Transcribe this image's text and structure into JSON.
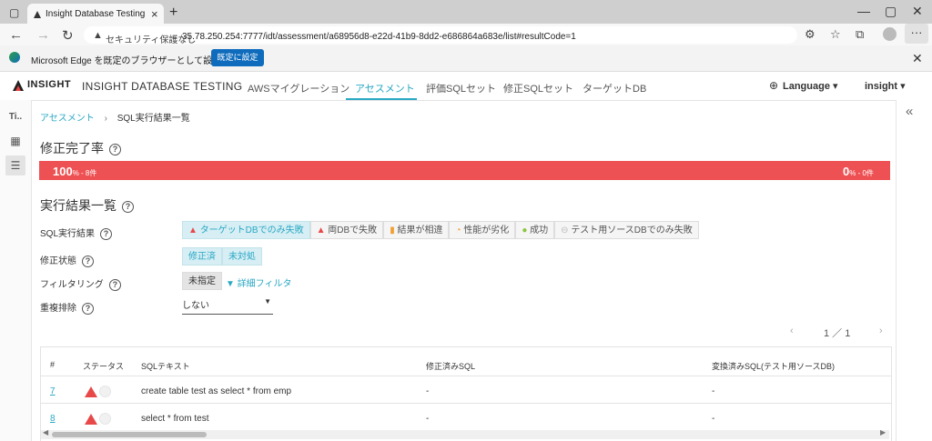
{
  "browser": {
    "tab_title": "Insight Database Testing",
    "insecure_label": "セキュリティ保護なし",
    "url": "35.78.250.254:7777/idt/assessment/a68956d8-e22d-41b9-8dd2-e686864a683e/list#resultCode=1",
    "infobar_text": "Microsoft Edge を既定のブラウザーとして設定しますか?",
    "infobar_button": "既定に設定"
  },
  "header": {
    "brand": "INSIGHT DATABASE TESTING",
    "logo_text": "INSIGHT",
    "nav": [
      "AWSマイグレーション",
      "アセスメント",
      "評価SQLセット",
      "修正SQLセット",
      "ターゲットDB"
    ],
    "active_nav": "アセスメント",
    "language": "Language",
    "user": "insight"
  },
  "sidebar": {
    "first_item": "Ti.."
  },
  "breadcrumb": {
    "parent": "アセスメント",
    "separator": "›",
    "current": "SQL実行結果一覧"
  },
  "completion": {
    "title": "修正完了率",
    "left_percent": "100",
    "left_suffix": "% - 8件",
    "right_percent": "0",
    "right_suffix": "% - 0件",
    "bar_color": "#ee5153"
  },
  "results": {
    "title": "実行結果一覧",
    "filters": {
      "sql_result_label": "SQL実行結果",
      "sql_result_chips": [
        "ターゲットDBでのみ失敗",
        "両DBで失敗",
        "結果が相違",
        "性能が劣化",
        "成功",
        "テスト用ソースDBでのみ失敗"
      ],
      "fix_status_label": "修正状態",
      "fix_status_chips": [
        "修正済",
        "未対処"
      ],
      "filtering_label": "フィルタリング",
      "filtering_value": "未指定",
      "detail_filter": "詳細フィルタ",
      "dedup_label": "重複排除",
      "dedup_value": "しない"
    },
    "pager": {
      "text": "1 ／ 1"
    },
    "table": {
      "headers": [
        "#",
        "ステータス",
        "SQLテキスト",
        "修正済みSQL",
        "変換済みSQL(テスト用ソースDB)"
      ],
      "rows": [
        {
          "id": "7",
          "sql": "create table test as select * from emp",
          "fixed": "-",
          "converted": "-"
        },
        {
          "id": "8",
          "sql": "select * from test",
          "fixed": "-",
          "converted": "-"
        }
      ]
    }
  },
  "colors": {
    "accent": "#2aa8c4",
    "danger": "#ee5153"
  }
}
